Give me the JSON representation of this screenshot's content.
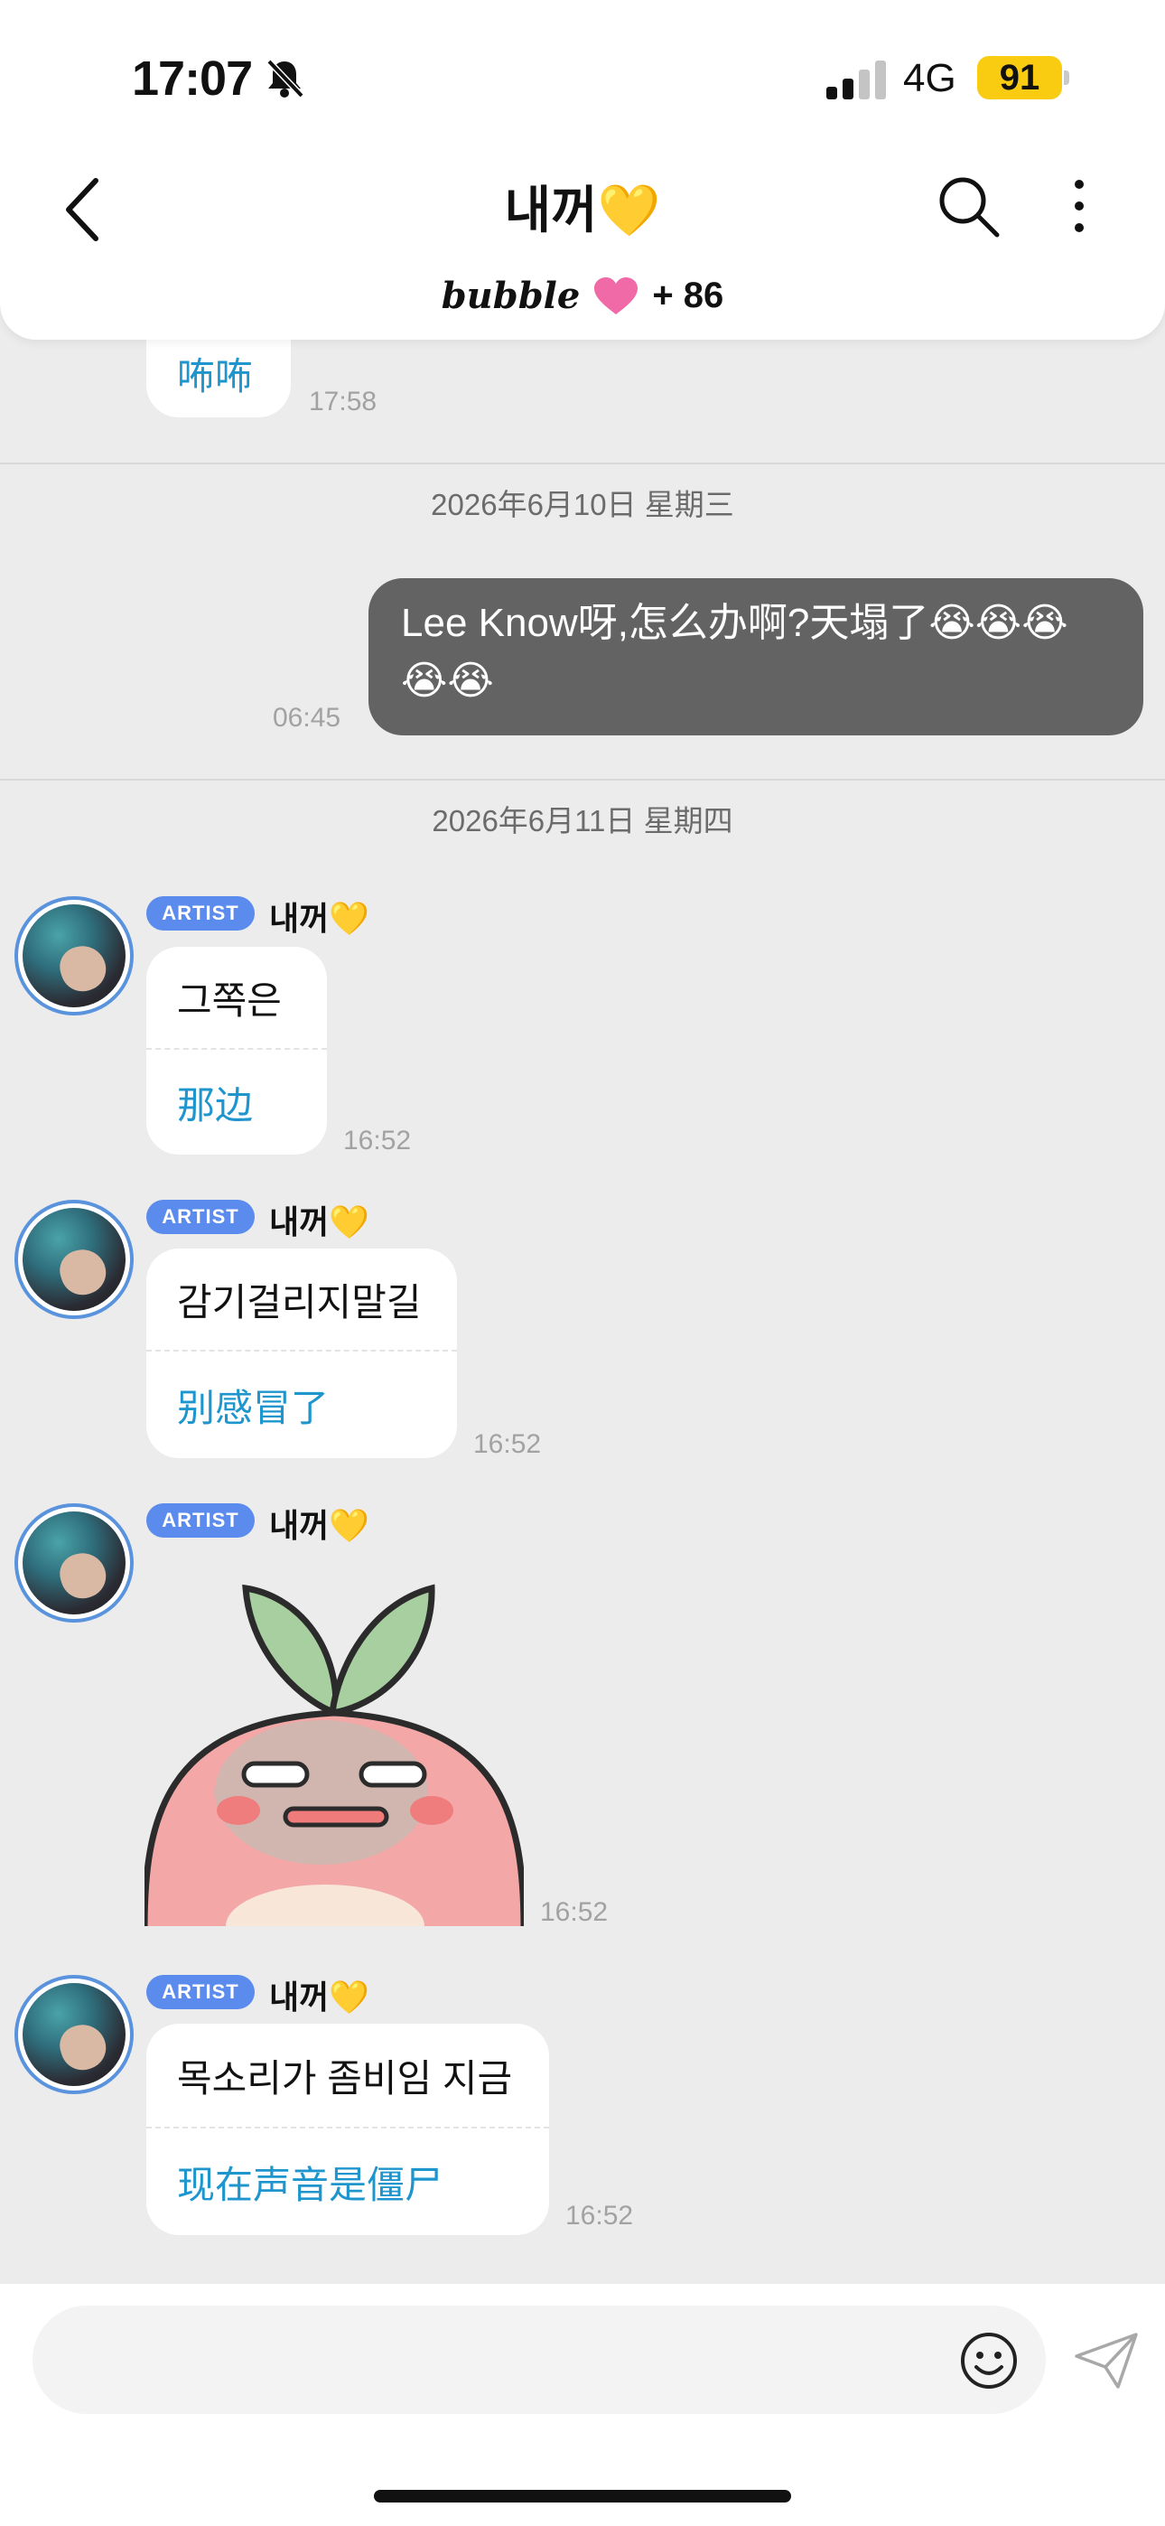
{
  "status_bar": {
    "time": "17:07",
    "network": "4G",
    "battery": "91"
  },
  "header": {
    "title": "내꺼💛",
    "brand": "bubble",
    "heart": "💗",
    "member_count": "+ 86"
  },
  "messages": {
    "partial": {
      "translation": "咘咘",
      "time": "17:58"
    },
    "date_1": "2026年6月10日 星期三",
    "outgoing": {
      "text": "Lee Know呀,怎么办啊?天塌了😭😭😭😭😭",
      "time": "06:45"
    },
    "date_2": "2026年6月11日 星期四",
    "artist_1": {
      "badge": "ARTIST",
      "sender": "내꺼💛",
      "original": "그쪽은",
      "translation": "那边",
      "time": "16:52"
    },
    "artist_2": {
      "badge": "ARTIST",
      "sender": "내꺼💛",
      "original": "감기걸리지말길",
      "translation": "别感冒了",
      "time": "16:52"
    },
    "artist_3": {
      "badge": "ARTIST",
      "sender": "내꺼💛",
      "sticker": "peach-sticker",
      "time": "16:52"
    },
    "artist_4": {
      "badge": "ARTIST",
      "sender": "내꺼💛",
      "original": "목소리가 좀비임 지금",
      "translation": "现在声音是僵尸",
      "time": "16:52"
    }
  },
  "input": {
    "placeholder": ""
  },
  "icons": {
    "back": "back-chevron-icon",
    "search": "search-icon",
    "more": "more-vertical-icon",
    "emoji": "emoji-icon",
    "send": "send-plane-icon",
    "bell": "bell-slash-icon"
  },
  "colors": {
    "background": "#ececec",
    "outgoing_bubble": "#636363",
    "translation_text": "#1e96cd",
    "artist_badge": "#5b8bec",
    "battery": "#f9cc11"
  }
}
